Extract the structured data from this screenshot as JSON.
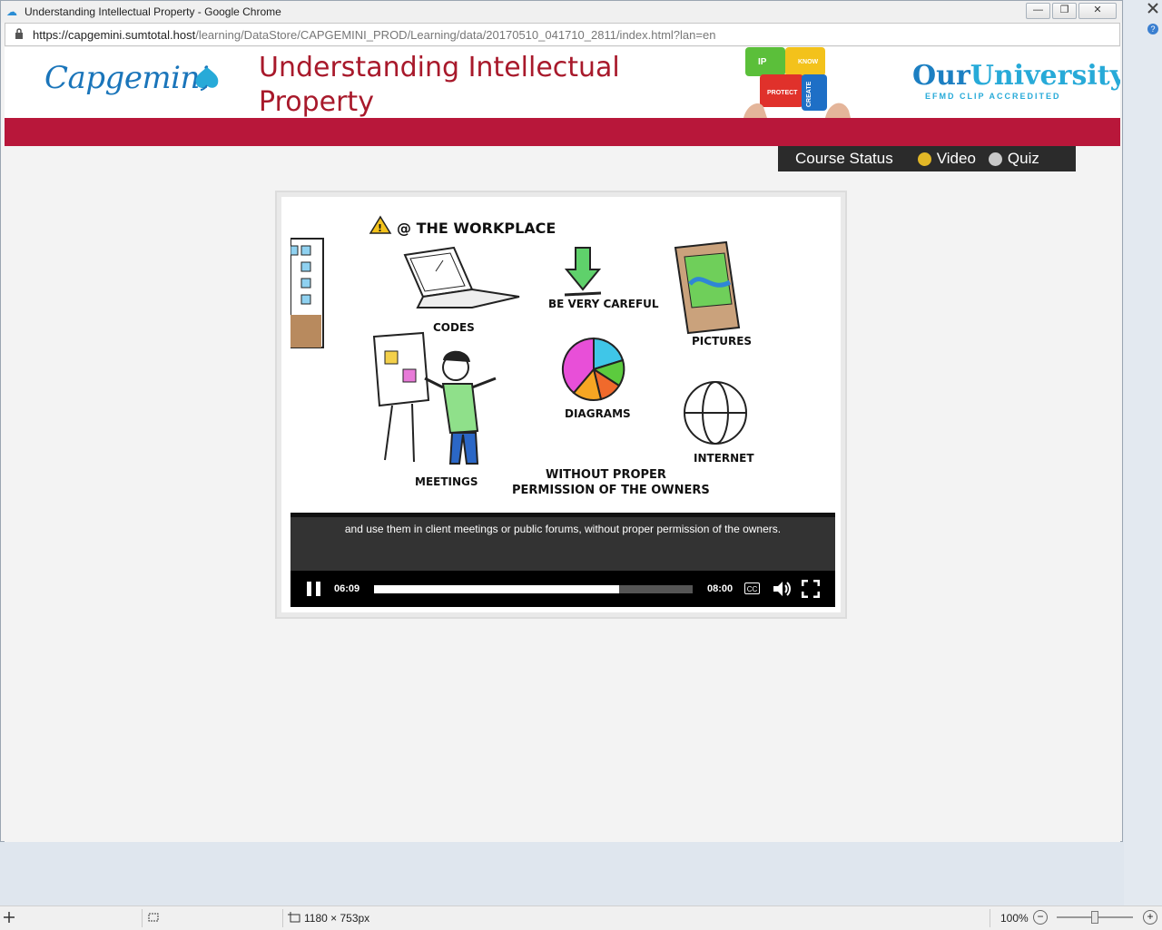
{
  "window": {
    "title": "Understanding Intellectual Property - Google Chrome",
    "minimize": "—",
    "maximize": "❐",
    "close": "✕"
  },
  "address_bar": {
    "host": "https://capgemini.sumtotal.host",
    "path": "/learning/DataStore/CAPGEMINI_PROD/Learning/data/20170510_041710_2811/index.html?lan=en"
  },
  "header": {
    "logo_text": "Capgemini",
    "course_title_line1": "Understanding Intellectual",
    "course_title_line2": "Property",
    "puzzle_labels": [
      "IP",
      "KNOW",
      "PROTECT",
      "CREATE"
    ],
    "university_part1": "Our",
    "university_part2": "University",
    "university_sub": "EFMD CLIP ACCREDITED"
  },
  "course_status": {
    "label": "Course Status",
    "items": [
      {
        "label": "Video",
        "state_color": "#e2b726"
      },
      {
        "label": "Quiz",
        "state_color": "#c9c9c9"
      }
    ]
  },
  "video": {
    "scene": {
      "heading": "@ THE WORKPLACE",
      "labels": {
        "codes": "CODES",
        "careful": "BE VERY CAREFUL",
        "pictures": "PICTURES",
        "diagrams": "DIAGRAMS",
        "meetings": "MEETINGS",
        "internet": "INTERNET",
        "without1": "WITHOUT PROPER",
        "without2": "PERMISSION OF THE OWNERS"
      }
    },
    "caption": "and use them in client meetings or public forums, without proper permission of the owners.",
    "current_time": "06:09",
    "duration": "08:00",
    "progress_fraction": 0.77,
    "cc_label": "CC"
  },
  "status_bar": {
    "dimensions": "1180 × 753px",
    "zoom": "100%",
    "zoom_slider_fraction": 0.5,
    "zoom_out": "−",
    "zoom_in": "+"
  }
}
